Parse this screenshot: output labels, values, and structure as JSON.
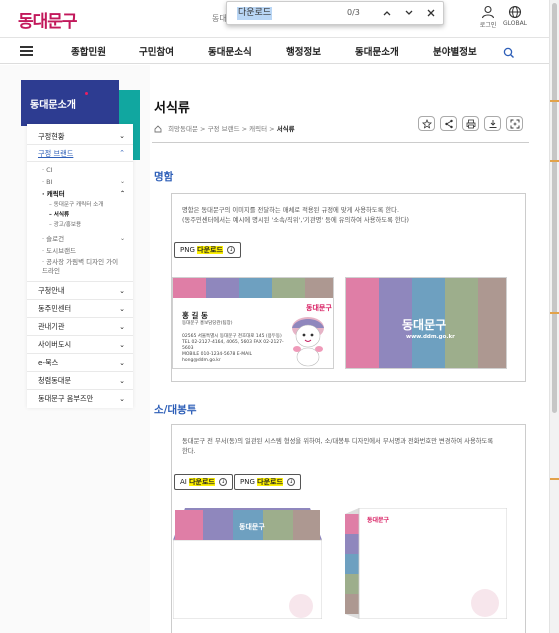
{
  "header": {
    "logo_text": "동대문구",
    "peek_text": "동대",
    "login_label": "로그인",
    "global_label": "GLOBAL"
  },
  "find": {
    "value": "다운로드",
    "count": "0/3",
    "prev_icon": "chevron-up-icon",
    "next_icon": "chevron-down-icon",
    "close_icon": "close-icon"
  },
  "nav": {
    "items": [
      "종합민원",
      "구민참여",
      "동대문소식",
      "행정정보",
      "동대문소개",
      "분야별정보"
    ]
  },
  "sidebar": {
    "title": "동대문소개",
    "items": [
      {
        "label": "구정현황",
        "chev": "⌄"
      },
      {
        "label": "구정 브랜드",
        "chev": "⌃"
      }
    ],
    "sub": [
      {
        "label": "CI"
      },
      {
        "label": "BI",
        "chev": "⌄"
      },
      {
        "label": "캐릭터",
        "chev": "⌃"
      }
    ],
    "subsub": [
      "동대문구 캐릭터 소개",
      "서식류",
      "광고/홍보용"
    ],
    "sub2": [
      {
        "label": "슬로건",
        "chev": "⌄"
      },
      {
        "label": "도시브랜드"
      },
      {
        "label": "공사장 가림벽 디자인 가이드라인"
      }
    ],
    "items2": [
      {
        "label": "구청안내",
        "chev": "⌄"
      },
      {
        "label": "동주민센터",
        "chev": "⌄"
      },
      {
        "label": "관내기관",
        "chev": "⌄"
      },
      {
        "label": "사이버도시",
        "chev": "⌄"
      },
      {
        "label": "e-북스",
        "chev": "⌄"
      },
      {
        "label": "청렴동대문",
        "chev": "⌄"
      },
      {
        "label": "동대문구 옴부즈만",
        "chev": "⌄"
      }
    ]
  },
  "page": {
    "title": "서식류",
    "breadcrumb": [
      "희망동대문",
      "구정 브랜드",
      "캐릭터"
    ],
    "breadcrumb_current": "서식류",
    "tools": [
      "star-icon",
      "share-icon",
      "print-icon",
      "download-icon",
      "expand-icon"
    ]
  },
  "sections": [
    {
      "title": "명함",
      "desc": [
        "명함은 동대문구의 이미지를 전달하는 매체로 적용된 규정에 맞게 사용하도록 한다.",
        "(동주민센터에서는 예시에 명시된 '소속/직위','기관명' 등에 유의하여 사용하도록 한다)"
      ],
      "buttons": [
        {
          "prefix": "PNG",
          "highlight": "다운로드"
        }
      ]
    },
    {
      "title": "소/대봉투",
      "desc": [
        "동대문구 전 부서(동)의 일관된 시스템 형성을 위하여, 소/대봉투 디자인에서 부서명과 전화번호만 변경하여 사용하도록",
        "한다."
      ],
      "buttons": [
        {
          "prefix": "AI",
          "highlight": "다운로드"
        },
        {
          "prefix": "PNG",
          "highlight": "다운로드"
        }
      ]
    }
  ],
  "card_front": {
    "name": "홍 길 동",
    "position": "동대문구 홍보담당관(팀장)",
    "lines": [
      "02565 서울특별시 동대문구 천호대로 145 (용두동)",
      "TEL 02-2127-4164, 4065, 5603  FAX 02-2127-5603",
      "MOBILE 010-1234-5678  E-MAIL hong@ddm.go.kr"
    ],
    "logo": "동대문구"
  },
  "card_back": {
    "logo": "동대문구",
    "url": "www.ddm.go.kr"
  },
  "envelope": {
    "logo": "동대문구"
  },
  "colors": {
    "accent_blue": "#2e5fb8",
    "sidebar_navy": "#2d3c91",
    "teal": "#11a7a0",
    "brand_pink": "#d81b60",
    "highlight": "#fff200",
    "strip_pink": "#df7ea6",
    "strip_purple": "#8f87bd",
    "strip_blue": "#6ea0c0",
    "strip_green": "#9dae8c",
    "strip_brown": "#ad9891"
  }
}
